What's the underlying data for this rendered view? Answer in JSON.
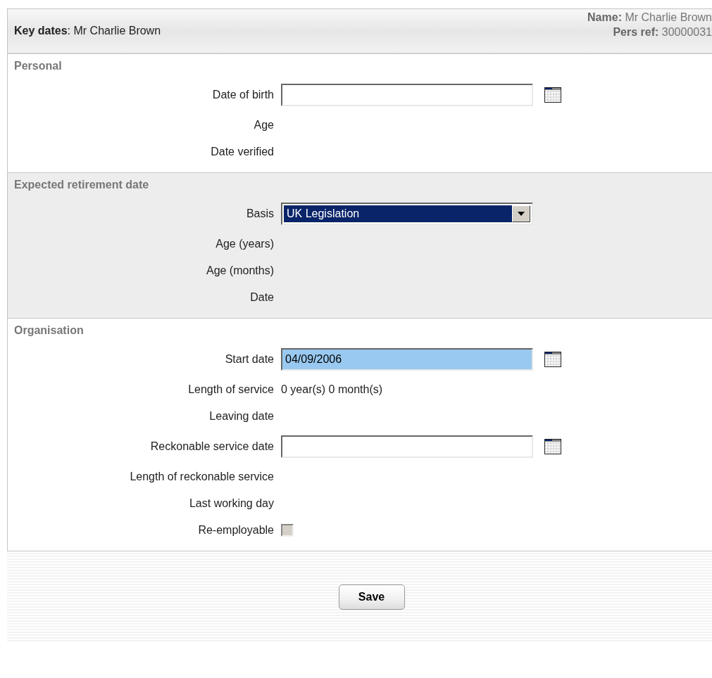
{
  "header": {
    "title": "**Key dates**: Mr Charlie Brown",
    "name_label": "Name:",
    "name_value": "Mr Charlie Brown",
    "ref_label": "Pers ref:",
    "ref_value": "30000031"
  },
  "sections": [
    {
      "title": "Personal",
      "shaded": false,
      "rows": [
        {
          "kind": "date",
          "label": "Date of birth",
          "value": "",
          "highlighted": false
        },
        {
          "kind": "text",
          "label": "Age"
        },
        {
          "kind": "text",
          "label": "Date verified"
        }
      ]
    },
    {
      "title": "Expected retirement date",
      "shaded": true,
      "rows": [
        {
          "kind": "select",
          "label": "Basis",
          "value": "UK Legislation",
          "focused": true
        },
        {
          "kind": "text",
          "label": "Age (years)"
        },
        {
          "kind": "text",
          "label": "Age (months)"
        },
        {
          "kind": "text",
          "label": "Date"
        }
      ]
    },
    {
      "title": "Organisation",
      "shaded": false,
      "rows": [
        {
          "kind": "date",
          "label": "Start date",
          "value": "04/09/2006",
          "highlighted": true
        },
        {
          "kind": "text",
          "label": "Length of service",
          "value": "0 year(s) 0 month(s)"
        },
        {
          "kind": "text",
          "label": "Leaving date"
        },
        {
          "kind": "date",
          "label": "Reckonable service date",
          "value": "",
          "highlighted": false
        },
        {
          "kind": "text",
          "label": "Length of reckonable service"
        },
        {
          "kind": "text",
          "label": "Last working day"
        },
        {
          "kind": "checkbox",
          "label": "Re-employable",
          "checked": false
        }
      ]
    }
  ],
  "save_button": "Save"
}
